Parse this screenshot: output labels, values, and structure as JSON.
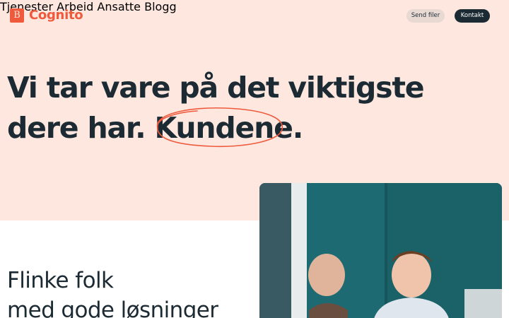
{
  "header": {
    "logo_mark": "B",
    "logo_text": "Cognito",
    "nav": [
      {
        "label": "Tjenester"
      },
      {
        "label": "Arbeid"
      },
      {
        "label": "Ansatte"
      },
      {
        "label": "Blogg"
      }
    ],
    "send_label": "Send filer",
    "contact_label": "Kontakt"
  },
  "hero": {
    "line1": "Vi tar vare på det viktigste",
    "line2_prefix": "dere har. ",
    "highlight": "Kundene",
    "line2_suffix": "."
  },
  "section": {
    "line1": "Flinke folk",
    "line2": "med gode løsninger"
  },
  "colors": {
    "accent": "#ef5a3c",
    "hero_bg": "#fde7df",
    "ink": "#1c2b33"
  }
}
